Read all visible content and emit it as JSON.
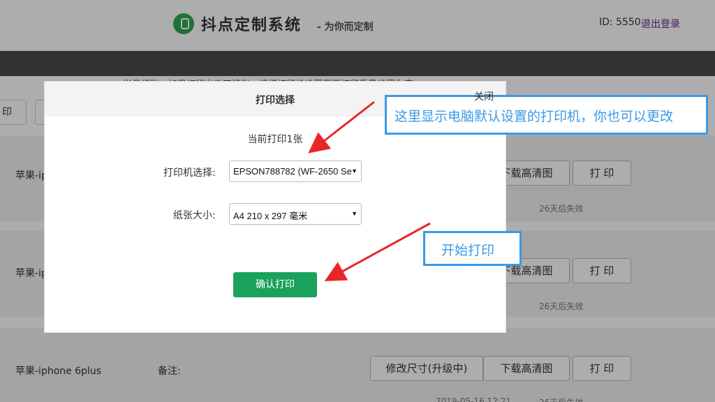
{
  "header": {
    "brand": "抖点定制系统",
    "subtitle": "- 为你而定制",
    "user_id": "ID: 5550",
    "logout": "退出登录"
  },
  "notice": "尚且记账，如果打印出来正请张，请把打印机设置里面打印质量设置为高",
  "toolbar": {
    "btn1": "印",
    "btn2": ""
  },
  "rows": [
    {
      "name": "苹果-ip",
      "note": "",
      "modify": "",
      "download": "下载高清图",
      "print": "打 印",
      "expire": "26天后失效",
      "date": ""
    },
    {
      "name": "苹果-ip",
      "note": "",
      "modify": "",
      "download": "下载高清图",
      "print": "打 印",
      "expire": "26天后失效",
      "date": ""
    },
    {
      "name": "苹果-iphone 6plus",
      "note": "备注:",
      "modify": "修改尺寸(升级中)",
      "download": "下载高清图",
      "print": "打 印",
      "expire": "26天后失效",
      "date": "2019-05-16 12:21"
    }
  ],
  "modal": {
    "title": "打印选择",
    "close": "关闭",
    "print_count": "当前打印1张",
    "printer_label": "打印机选择:",
    "printer_value": "EPSON788782 (WF-2650 Se",
    "paper_label": "纸张大小:",
    "paper_value": "A4 210 x 297 毫米",
    "confirm": "确认打印"
  },
  "callouts": {
    "printer_hint": "这里显示电脑默认设置的打印机，你也可以更改",
    "start_hint": "开始打印"
  },
  "colors": {
    "accent_green": "#1aa25c",
    "callout_blue": "#3b9ae6",
    "arrow_red": "#e8262a",
    "logout_purple": "#5b2a86"
  }
}
